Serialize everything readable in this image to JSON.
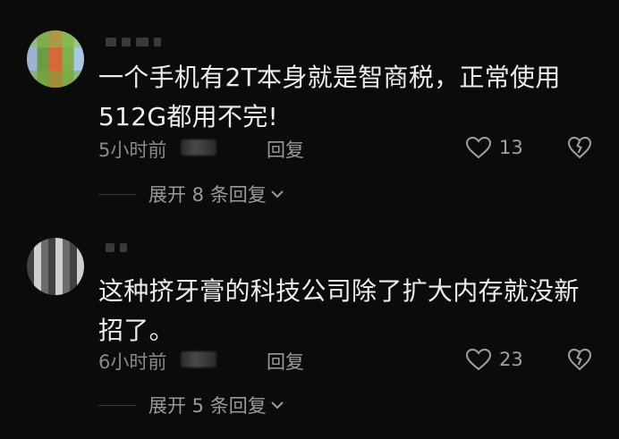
{
  "comments": [
    {
      "text": "一个手机有2T本身就是智商税，正常使用512G都用不完!",
      "time": "5小时前",
      "reply_label": "回复",
      "likes": "13",
      "expand_label": "展开 8 条回复"
    },
    {
      "text": "这种挤牙膏的科技公司除了扩大内存就没新招了。",
      "time": "6小时前",
      "reply_label": "回复",
      "likes": "23",
      "expand_label": "展开 5 条回复"
    }
  ],
  "icons": {
    "like": "heart-icon",
    "dislike": "broken-heart-icon",
    "expand": "chevron-down-icon"
  },
  "colors": {
    "background": "#0b0b0b",
    "text": "#ececec",
    "muted": "#8a8a8a"
  }
}
